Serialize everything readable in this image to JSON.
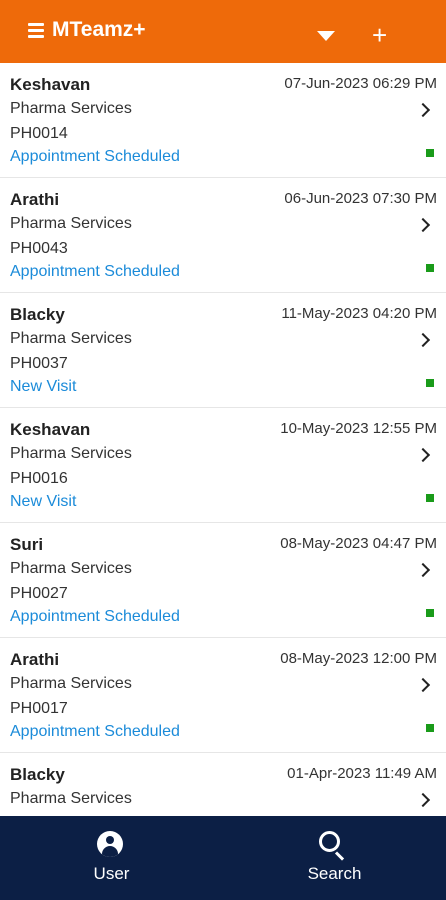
{
  "app": {
    "title": "MTeamz+"
  },
  "appbar": {
    "menu_icon": "menu-icon",
    "dropdown_icon": "dropdown-triangle-icon",
    "add_icon": "plus-icon",
    "add_label": "+"
  },
  "list": [
    {
      "name": "Keshavan",
      "datetime": "07-Jun-2023 06:29 PM",
      "service": "Pharma Services",
      "code": "PH0014",
      "status": "Appointment Scheduled"
    },
    {
      "name": "Arathi",
      "datetime": "06-Jun-2023 07:30 PM",
      "service": "Pharma Services",
      "code": "PH0043",
      "status": "Appointment Scheduled"
    },
    {
      "name": "Blacky",
      "datetime": "11-May-2023 04:20 PM",
      "service": "Pharma Services",
      "code": "PH0037",
      "status": "New Visit"
    },
    {
      "name": "Keshavan",
      "datetime": "10-May-2023 12:55 PM",
      "service": "Pharma Services",
      "code": "PH0016",
      "status": "New Visit"
    },
    {
      "name": "Suri",
      "datetime": "08-May-2023 04:47 PM",
      "service": "Pharma Services",
      "code": "PH0027",
      "status": "Appointment Scheduled"
    },
    {
      "name": "Arathi",
      "datetime": "08-May-2023 12:00 PM",
      "service": "Pharma Services",
      "code": "PH0017",
      "status": "Appointment Scheduled"
    },
    {
      "name": "Blacky",
      "datetime": "01-Apr-2023 11:49 AM",
      "service": "Pharma Services",
      "code": "",
      "status": ""
    }
  ],
  "colors": {
    "appbar": "#ee6a0a",
    "bottombar": "#0c1f45",
    "status_text": "#1b8bd9",
    "status_dot": "#1a9b1a"
  },
  "bottom_nav": {
    "user": {
      "label": "User",
      "icon": "user-icon"
    },
    "search": {
      "label": "Search",
      "icon": "search-icon"
    }
  }
}
